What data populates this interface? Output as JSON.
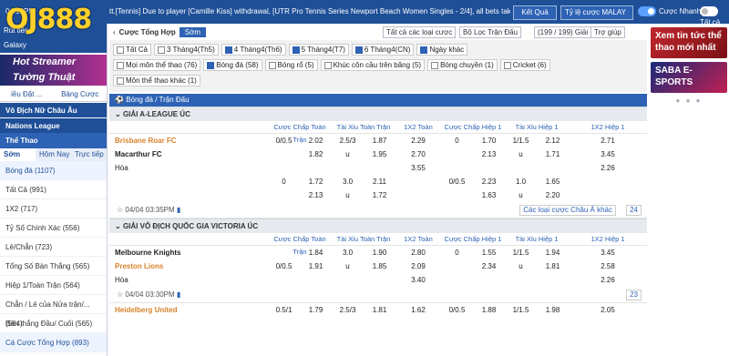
{
  "topbar": {
    "time": "04:10PM",
    "marquee": "tt.[Tennis] Due to player [Camille Kiss] withdrawal, [UTR Pro Tennis Series Newport Beach Women Singles - 2/4], all bets taken",
    "logo": "OJ888",
    "ket_qua": "Kết Quả",
    "odds_type": "Tỷ lệ cược MALAY",
    "toggle_fast": "Cược Nhanh",
    "toggle_all": "Tất cả"
  },
  "sidebar": {
    "menu_prefix": "Rút tiền",
    "galaxy": "Galaxy",
    "banner": "Hot Streamer Tường Thuật",
    "tabs": [
      "iều Đặt ...",
      "Bảng Cược"
    ],
    "sections": [
      "Vô Địch Nữ Châu Âu",
      "Nations League",
      "Thể Thao"
    ],
    "sub_tabs": [
      "Sớm",
      "Hôm Nay",
      "Trực tiếp"
    ],
    "items": [
      "Bóng đá (1107)",
      "Tất Cả (991)",
      "1X2 (717)",
      "Tỷ Số Chính Xác (556)",
      "Lẻ/Chẵn (723)",
      "Tổng Số Bàn Thắng (565)",
      "Hiệp 1/Toàn Trận (564)",
      "Chẵn / Lẻ của Nửa trận/... (564)",
      "Bàn thắng Đầu/ Cuối (565)",
      "Cá Cược Tổng Hợp (893)"
    ]
  },
  "main": {
    "title": "Cược Tổng Hợp",
    "som": "Sớm",
    "sel_bet": "Tất cả các loại cược",
    "sel_filter": "Bộ Lọc Trận Đấu",
    "page": "(199 / 199) Giải",
    "help": "Trợ giúp",
    "date_chips": [
      "Tất Cả",
      "3 Tháng4(Th5)",
      "4 Tháng4(Th6)",
      "5 Tháng4(T7)",
      "6 Tháng4(CN)",
      "Ngày khác"
    ],
    "sport_chips": [
      "Mọi môn thể thao (76)",
      "Bóng đá (58)",
      "Bóng rổ (5)",
      "Khúc côn cầu trên băng (5)",
      "Bóng chuyền (1)",
      "Cricket (6)",
      "Môn thể thao khác (1)"
    ],
    "sport_bar": "Bóng đá / Trận Đấu",
    "col_headers": [
      "Cược Chấp Toàn Trận",
      "Tài Xỉu Toàn Trận",
      "1X2 Toàn",
      "Cược Chấp Hiệp 1",
      "Tài Xỉu Hiệp 1",
      "1X2 Hiệp 1"
    ],
    "leagues": [
      {
        "name": "GIẢI A-LEAGUE ÚC",
        "rows": [
          [
            "Brisbane Roar FC",
            "0/0.5",
            "2.02",
            "2.5/3",
            "1.87",
            "2.29",
            "0",
            "1.70",
            "1/1.5",
            "2.12",
            "2.71"
          ],
          [
            "Macarthur FC",
            "",
            "1.82",
            "u",
            "1.95",
            "2.70",
            "",
            "2.13",
            "u",
            "1.71",
            "3.45"
          ],
          [
            "Hòa",
            "",
            "",
            "",
            "",
            "3.55",
            "",
            "",
            "",
            "",
            "2.26"
          ],
          [
            "",
            "0",
            "1.72",
            "3.0",
            "2.11",
            "",
            "0/0.5",
            "2.23",
            "1.0",
            "1.65",
            ""
          ],
          [
            "",
            "",
            "2.13",
            "u",
            "1.72",
            "",
            "",
            "1.63",
            "u",
            "2.20",
            ""
          ]
        ],
        "time": "04/04 03:35PM",
        "more": "Các loại cược Châu Á khác",
        "count": "24"
      },
      {
        "name": "GIẢI VÔ ĐỊCH QUỐC GIA VICTORIA ÚC",
        "rows": [
          [
            "Melbourne Knights",
            "",
            "1.84",
            "3.0",
            "1.90",
            "2.80",
            "0",
            "1.55",
            "1/1.5",
            "1.94",
            "3.45"
          ],
          [
            "Preston Lions",
            "0/0.5",
            "1.91",
            "u",
            "1.85",
            "2.09",
            "",
            "2.34",
            "u",
            "1.81",
            "2.58"
          ],
          [
            "Hòa",
            "",
            "",
            "",
            "",
            "3.40",
            "",
            "",
            "",
            "",
            "2.26"
          ]
        ],
        "time": "04/04 03:30PM",
        "count": "23"
      }
    ],
    "next_row": [
      "Heidelberg United",
      "0.5/1",
      "1.79",
      "2.5/3",
      "1.81",
      "1.62",
      "0/0.5",
      "1.88",
      "1/1.5",
      "1.98",
      "2.05"
    ]
  },
  "ads": {
    "ad1": "Xem tin tức thể thao mới nhất",
    "ad2": "SABA E-SPORTS"
  }
}
